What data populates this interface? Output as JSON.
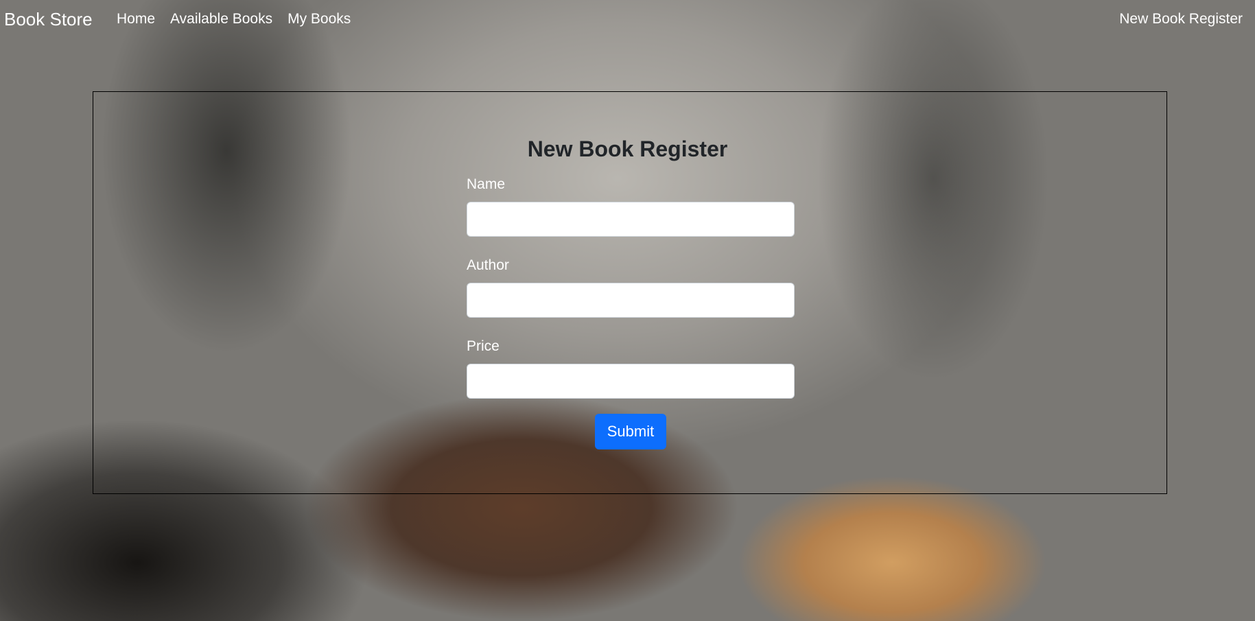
{
  "navbar": {
    "brand": "Book Store",
    "links": [
      "Home",
      "Available Books",
      "My Books"
    ],
    "right_link": "New Book Register"
  },
  "form": {
    "title": "New Book Register",
    "fields": [
      {
        "label": "Name",
        "value": ""
      },
      {
        "label": "Author",
        "value": ""
      },
      {
        "label": "Price",
        "value": ""
      }
    ],
    "submit_label": "Submit"
  },
  "colors": {
    "submit_button": "#0d6efd",
    "nav_text": "#ffffff",
    "title_text": "#212529"
  }
}
